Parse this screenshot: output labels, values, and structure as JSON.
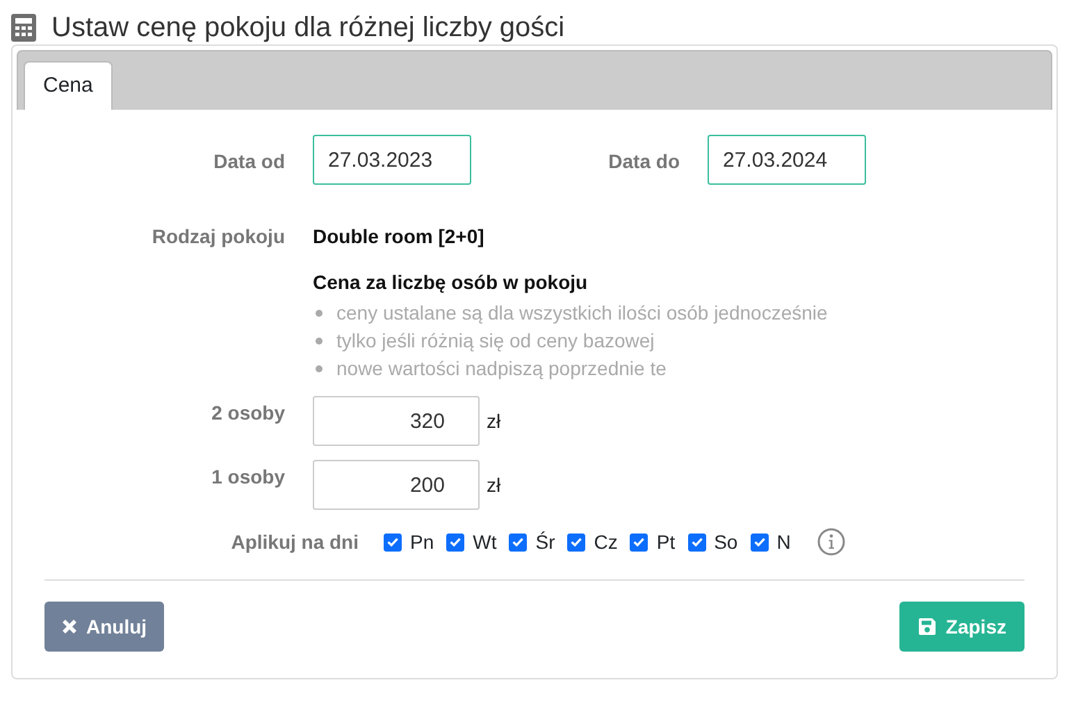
{
  "title": "Ustaw cenę pokoju dla różnej liczby gości",
  "tabs": [
    {
      "label": "Cena",
      "selected": true
    }
  ],
  "date_from": {
    "label": "Data od",
    "value": "27.03.2023"
  },
  "date_to": {
    "label": "Data do",
    "value": "27.03.2024"
  },
  "room_type": {
    "label": "Rodzaj pokoju",
    "value": "Double room [2+0]"
  },
  "price_section": {
    "heading": "Cena za liczbę osób w pokoju",
    "notes": [
      "ceny ustalane są dla wszystkich ilości osób jednocześnie",
      "tylko jeśli różnią się od ceny bazowej",
      "nowe wartości nadpiszą poprzednie te"
    ]
  },
  "prices": [
    {
      "label": "2 osoby",
      "value": "320",
      "unit": "zł"
    },
    {
      "label": "1 osoby",
      "value": "200",
      "unit": "zł"
    }
  ],
  "apply_days": {
    "label": "Aplikuj na dni",
    "days": [
      {
        "label": "Pn",
        "checked": true
      },
      {
        "label": "Wt",
        "checked": true
      },
      {
        "label": "Śr",
        "checked": true
      },
      {
        "label": "Cz",
        "checked": true
      },
      {
        "label": "Pt",
        "checked": true
      },
      {
        "label": "So",
        "checked": true
      },
      {
        "label": "N",
        "checked": true
      }
    ]
  },
  "buttons": [
    {
      "kind": "cancel",
      "label": "Anuluj"
    },
    {
      "kind": "save",
      "label": "Zapisz"
    }
  ]
}
